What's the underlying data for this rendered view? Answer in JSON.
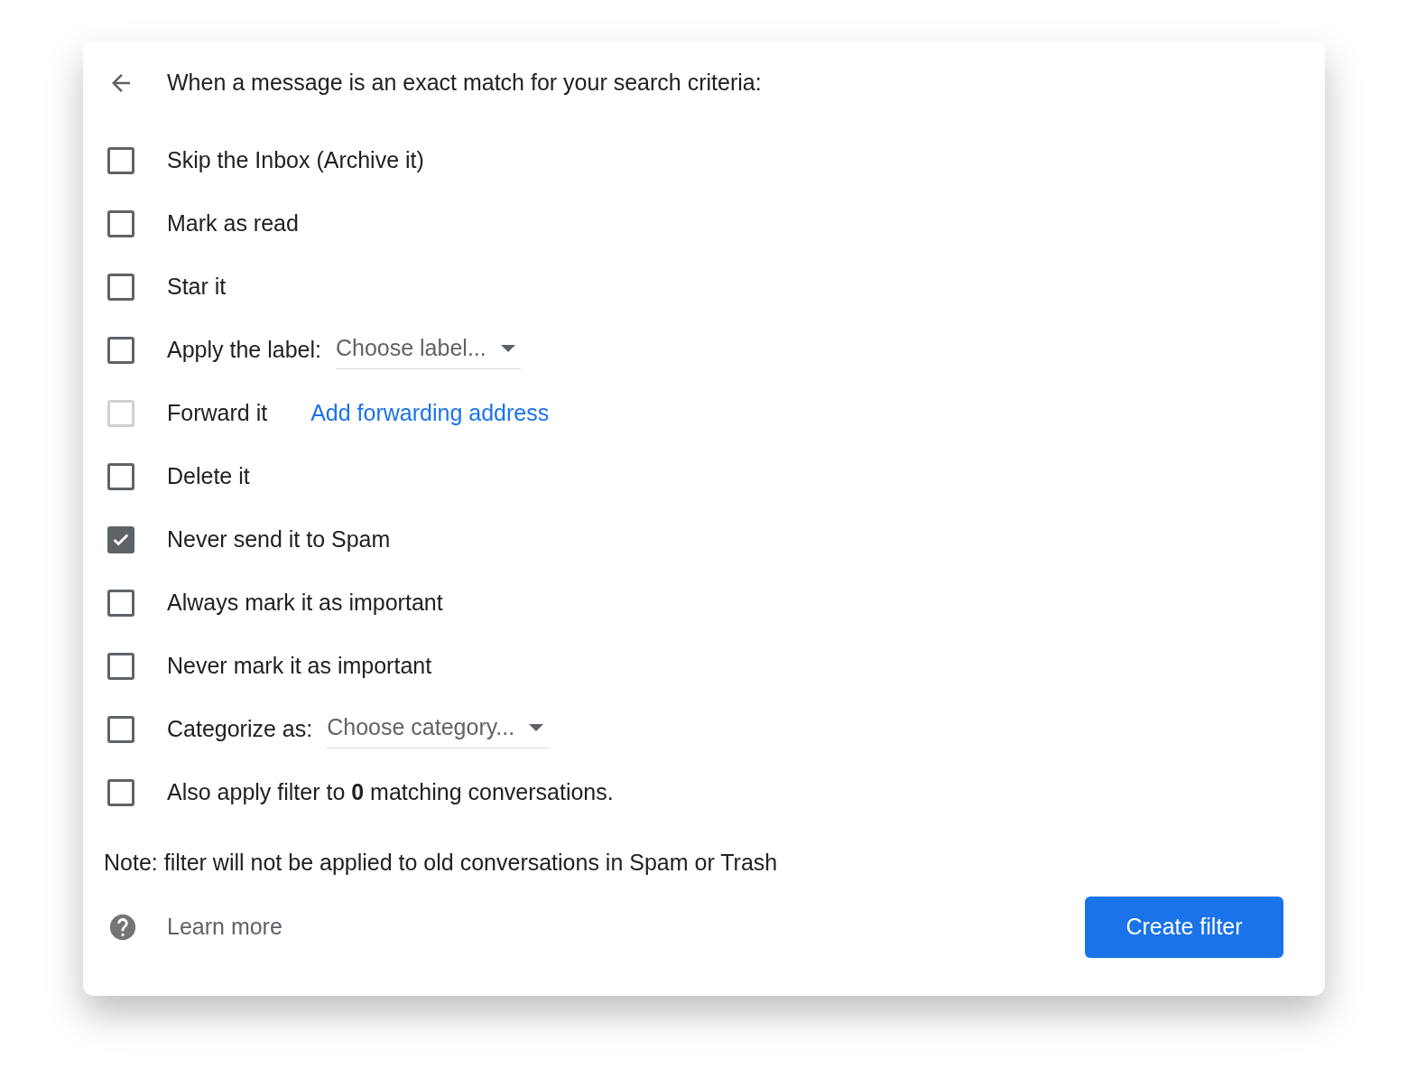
{
  "header": {
    "title": "When a message is an exact match for your search criteria:"
  },
  "options": [
    {
      "kind": "plain",
      "label": "Skip the Inbox (Archive it)",
      "checked": false,
      "disabled": false
    },
    {
      "kind": "plain",
      "label": "Mark as read",
      "checked": false,
      "disabled": false
    },
    {
      "kind": "plain",
      "label": "Star it",
      "checked": false,
      "disabled": false
    },
    {
      "kind": "select",
      "label": "Apply the label:",
      "select": "Choose label...",
      "checked": false,
      "disabled": false
    },
    {
      "kind": "link",
      "label": "Forward it",
      "link": "Add forwarding address",
      "checked": false,
      "disabled": true
    },
    {
      "kind": "plain",
      "label": "Delete it",
      "checked": false,
      "disabled": false
    },
    {
      "kind": "plain",
      "label": "Never send it to Spam",
      "checked": true,
      "disabled": false
    },
    {
      "kind": "plain",
      "label": "Always mark it as important",
      "checked": false,
      "disabled": false
    },
    {
      "kind": "plain",
      "label": "Never mark it as important",
      "checked": false,
      "disabled": false
    },
    {
      "kind": "select",
      "label": "Categorize as:",
      "select": "Choose category...",
      "checked": false,
      "disabled": false
    },
    {
      "kind": "plain",
      "label": "Also apply filter to **0** matching conversations.",
      "checked": false,
      "disabled": false
    }
  ],
  "note": "Note: filter will not be applied to old conversations in Spam or Trash",
  "help": {
    "label": "Learn more"
  },
  "button": "Create filter"
}
